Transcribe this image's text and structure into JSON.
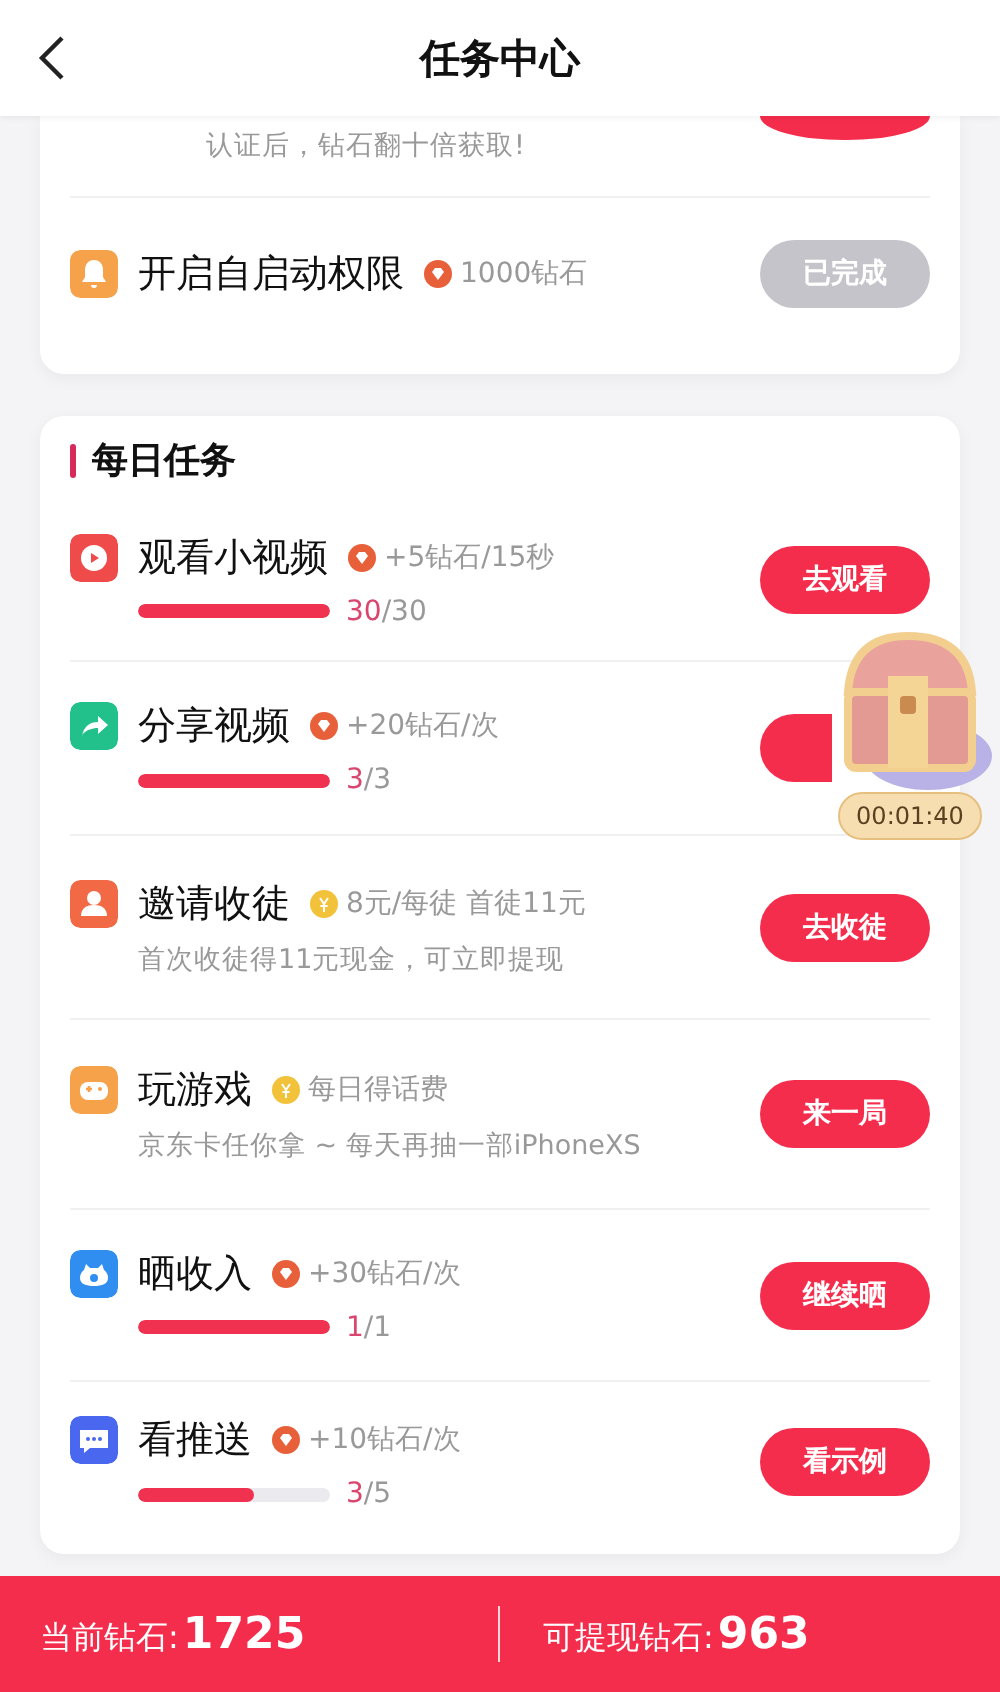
{
  "header": {
    "title": "任务中心"
  },
  "top_card": {
    "partial_row": {
      "subtitle": "认证后，钻石翻十倍获取!",
      "button": {
        "disabled": false
      }
    },
    "tasks": [
      {
        "kind": "bell",
        "color": "#f6a24a",
        "title": "开启自启动权限",
        "reward": {
          "kind": "diamond",
          "text": "1000钻石"
        },
        "button": {
          "label": "已完成",
          "disabled": true
        }
      }
    ]
  },
  "daily": {
    "title": "每日任务",
    "tasks": [
      {
        "kind": "video",
        "color": "#ef4b4b",
        "title": "观看小视频",
        "reward": {
          "kind": "diamond",
          "text": "+5钻石/15秒"
        },
        "progress": {
          "level": 1,
          "current": "30",
          "total": "/30"
        },
        "button": {
          "label": "去观看",
          "disabled": false
        }
      },
      {
        "kind": "share",
        "color": "#22c08a",
        "title": "分享视频",
        "reward": {
          "kind": "diamond",
          "text": "+20钻石/次"
        },
        "progress": {
          "level": 1,
          "current": "3",
          "total": "/3"
        },
        "button": {
          "disabled": false
        }
      },
      {
        "kind": "user",
        "color": "#f26a45",
        "title": "邀请收徒",
        "reward": {
          "kind": "coin",
          "text": "8元/每徒 首徒11元"
        },
        "subtitle": "首次收徒得11元现金，可立即提现",
        "button": {
          "label": "去收徒",
          "disabled": false
        }
      },
      {
        "kind": "game",
        "color": "#f6a24a",
        "title": "玩游戏",
        "reward": {
          "kind": "coin",
          "text": "每日得话费"
        },
        "subtitle": "京东卡任你拿 ~ 每天再抽一部iPhoneXS",
        "button": {
          "label": "来一局",
          "disabled": false
        }
      },
      {
        "kind": "wallet",
        "color": "#2f8ef0",
        "title": "晒收入",
        "reward": {
          "kind": "diamond",
          "text": "+30钻石/次"
        },
        "progress": {
          "level": 1,
          "current": "1",
          "total": "/1"
        },
        "button": {
          "label": "继续晒",
          "disabled": false
        }
      },
      {
        "kind": "chat",
        "color": "#4a67f0",
        "title": "看推送",
        "reward": {
          "kind": "diamond",
          "text": "+10钻石/次"
        },
        "progress": {
          "level": 0.6,
          "current": "3",
          "total": "/5"
        },
        "button": {
          "label": "看示例",
          "disabled": false
        }
      }
    ]
  },
  "chest": {
    "timer": "00:01:40"
  },
  "footer": {
    "current_label": "当前钻石:",
    "current_value": "1725",
    "withdraw_label": "可提现钻石:",
    "withdraw_value": "963"
  }
}
